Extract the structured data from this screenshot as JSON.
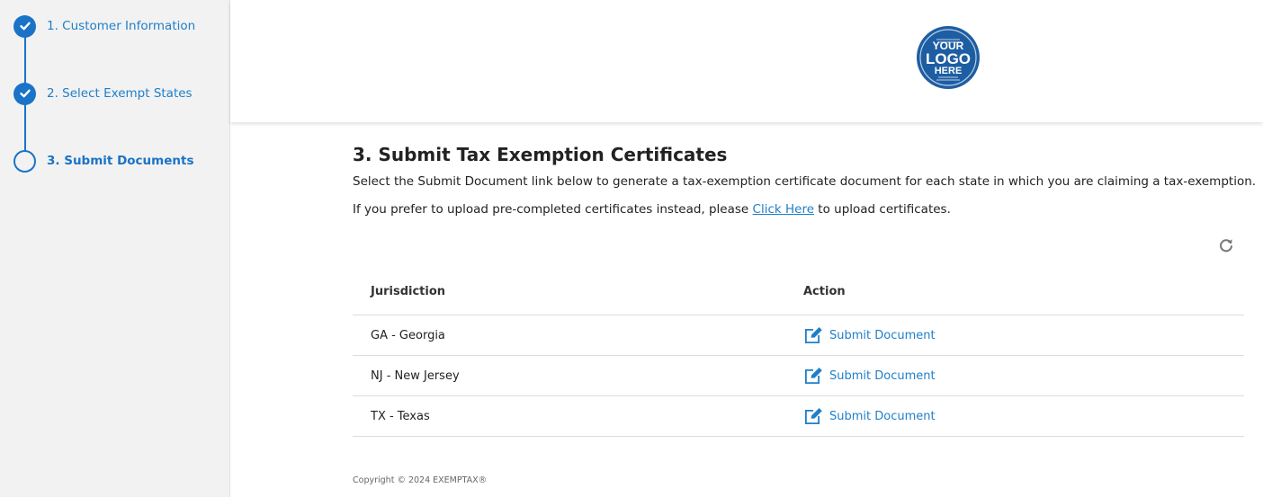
{
  "colors": {
    "accent": "#1a73c7",
    "link": "#1f7fc9",
    "logo": "#1d5ea3",
    "arrow": "#e02020"
  },
  "sidebar": {
    "steps": [
      {
        "label": "1. Customer Information",
        "status": "completed",
        "icon": "check-icon"
      },
      {
        "label": "2. Select Exempt States",
        "status": "completed",
        "icon": "check-icon"
      },
      {
        "label": "3. Submit Documents",
        "status": "current",
        "icon": "circle-icon"
      }
    ]
  },
  "header": {
    "logo": {
      "line1": "YOUR",
      "line2": "LOGO",
      "line3": "HERE"
    }
  },
  "main": {
    "title": "3. Submit Tax Exemption Certificates",
    "description": "Select the Submit Document link below to generate a tax-exemption certificate document for each state in which you are claiming a tax-exemption.",
    "upload_prefix": "If you prefer to upload pre-completed certificates instead, please ",
    "upload_link": "Click Here",
    "upload_suffix": " to upload certificates.",
    "refresh_icon": "refresh-icon"
  },
  "table": {
    "headers": {
      "jurisdiction": "Jurisdiction",
      "action": "Action"
    },
    "rows": [
      {
        "jurisdiction": "GA - Georgia",
        "action": "Submit Document",
        "icon": "edit-icon"
      },
      {
        "jurisdiction": "NJ - New Jersey",
        "action": "Submit Document",
        "icon": "edit-icon"
      },
      {
        "jurisdiction": "TX - Texas",
        "action": "Submit Document",
        "icon": "edit-icon"
      }
    ]
  },
  "footer": {
    "copyright": "Copyright © 2024 EXEMPTAX®"
  }
}
